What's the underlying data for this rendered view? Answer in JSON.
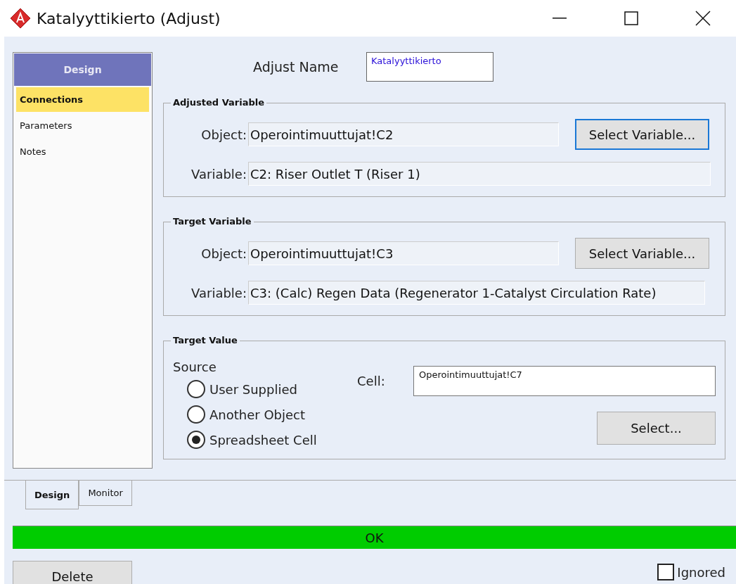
{
  "window": {
    "title": "Katalyyttikierto (Adjust)"
  },
  "sidebar": {
    "header": "Design",
    "items": [
      {
        "label": "Connections",
        "selected": true
      },
      {
        "label": "Parameters",
        "selected": false
      },
      {
        "label": "Notes",
        "selected": false
      }
    ]
  },
  "adjust_name": {
    "label": "Adjust Name",
    "value": "Katalyyttikierto"
  },
  "variable_groups": [
    {
      "title": "Adjusted Variable",
      "object_label": "Object:",
      "object_value": "Operointimuuttujat!C2",
      "variable_label": "Variable:",
      "variable_value": "C2: Riser Outlet T (Riser 1)",
      "button": {
        "label": "Select Variable...",
        "focused": true
      }
    },
    {
      "title": "Target Variable",
      "object_label": "Object:",
      "object_value": "Operointimuuttujat!C3",
      "variable_label": "Variable:",
      "variable_value": "C3: (Calc) Regen Data (Regenerator 1-Catalyst Circulation Rate)",
      "button": {
        "label": "Select Variable...",
        "focused": false
      }
    }
  ],
  "target_value": {
    "title": "Target Value",
    "source_label": "Source",
    "options": [
      {
        "label": "User Supplied",
        "selected": false
      },
      {
        "label": "Another Object",
        "selected": false
      },
      {
        "label": "Spreadsheet Cell",
        "selected": true
      }
    ],
    "cell_label": "Cell:",
    "cell_value": "Operointimuuttujat!C7",
    "button": "Select..."
  },
  "bottom_tabs": [
    {
      "label": "Design",
      "selected": true
    },
    {
      "label": "Monitor",
      "selected": false
    }
  ],
  "status": {
    "text": "OK"
  },
  "delete_button": "Delete",
  "ignored": {
    "label": "Ignored",
    "checked": false
  }
}
